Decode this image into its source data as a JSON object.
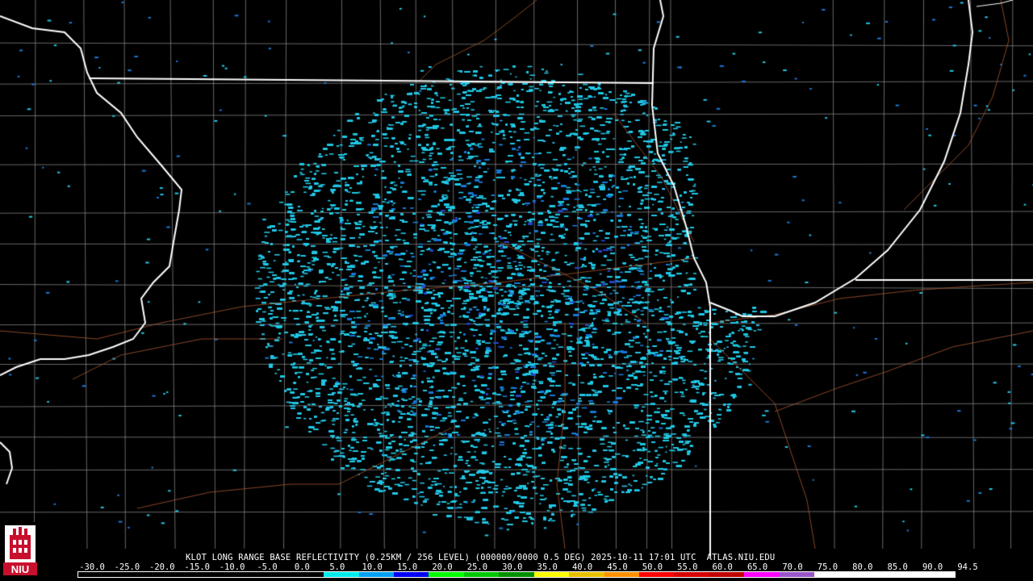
{
  "caption": "KLOT LONG RANGE BASE REFLECTIVITY (0.25KM / 256 LEVEL) (000000/0000 0.5 DEG) 2025-10-11 17:01 UTC  ATLAS.NIU.EDU",
  "logo": {
    "text": "NIU",
    "icon": "niu-tower-logo"
  },
  "color_scale": {
    "labels": [
      "-30.0",
      "-25.0",
      "-20.0",
      "-15.0",
      "-10.0",
      "-5.0",
      "0.0",
      "5.0",
      "10.0",
      "15.0",
      "20.0",
      "25.0",
      "30.0",
      "35.0",
      "40.0",
      "45.0",
      "50.0",
      "55.0",
      "60.0",
      "65.0",
      "70.0",
      "75.0",
      "80.0",
      "85.0",
      "90.0",
      "94.5"
    ],
    "colors": [
      "#000000",
      "#000000",
      "#000000",
      "#000000",
      "#000000",
      "#000000",
      "#000000",
      "#00ecec",
      "#01a0f6",
      "#0000f6",
      "#00ff00",
      "#00c800",
      "#009000",
      "#ffff00",
      "#e7c000",
      "#ff9000",
      "#ff0000",
      "#d60000",
      "#c00000",
      "#ff00ff",
      "#9955c9",
      "#ffffff",
      "#ffffff",
      "#ffffff",
      "#ffffff"
    ]
  },
  "map": {
    "radar_site": "KLOT",
    "colors": {
      "background": "#000000",
      "state_borders": "#ffffff",
      "county_lines": "#8a8a8a",
      "roads": "#a0522d",
      "echo_light": "#23c8e6",
      "echo_mid": "#1a7ad8",
      "echo_strong": "#2a45c8"
    }
  }
}
